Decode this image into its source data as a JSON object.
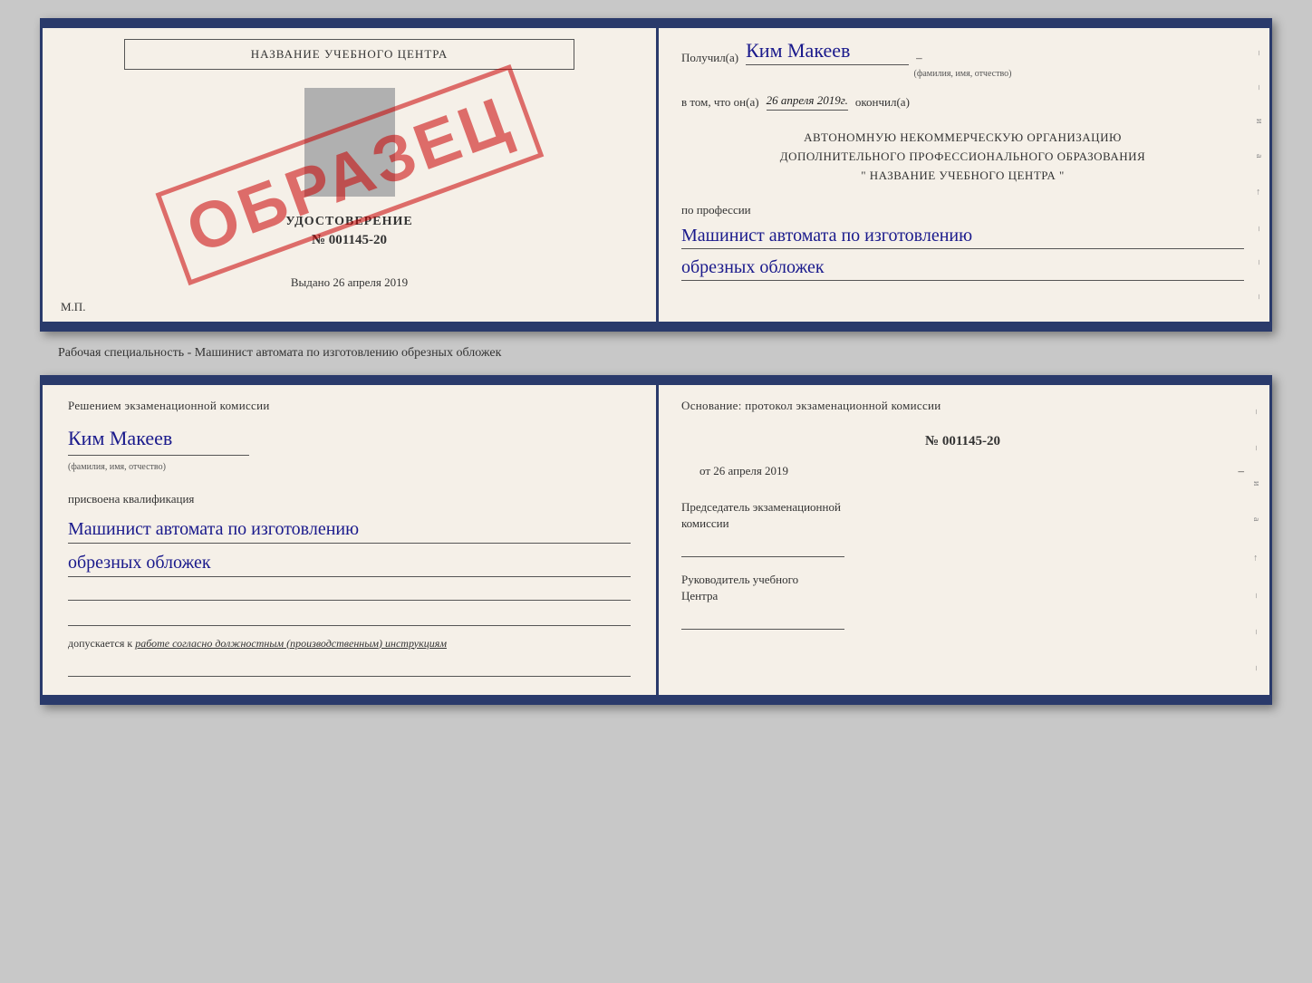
{
  "doc1": {
    "left": {
      "school_name": "НАЗВАНИЕ УЧЕБНОГО ЦЕНТРА",
      "udostoverenie_label": "УДОСТОВЕРЕНИЕ",
      "number": "№ 001145-20",
      "vydano_label": "Выдано",
      "vydano_date": "26 апреля 2019",
      "mp_label": "М.П.",
      "obrazec": "ОБРАЗЕЦ"
    },
    "right": {
      "poluchil": "Получил(a)",
      "name": "Ким Макеев",
      "fio_hint": "(фамилия, имя, отчество)",
      "dash1": "–",
      "v_tom": "в том, что он(а)",
      "date": "26 апреля 2019г.",
      "okonchil": "окончил(а)",
      "org_line1": "АВТОНОМНУЮ НЕКОММЕРЧЕСКУЮ ОРГАНИЗАЦИЮ",
      "org_line2": "ДОПОЛНИТЕЛЬНОГО ПРОФЕССИОНАЛЬНОГО ОБРАЗОВАНИЯ",
      "org_name": "\"  НАЗВАНИЕ УЧЕБНОГО ЦЕНТРА  \"",
      "po_professii": "по профессии",
      "profession1": "Машинист автомата по изготовлению",
      "profession2": "обрезных обложек"
    }
  },
  "separator": {
    "text": "Рабочая специальность - Машинист автомата по изготовлению обрезных обложек"
  },
  "doc2": {
    "left": {
      "resheniem": "Решением экзаменационной комиссии",
      "name": "Ким Макеев",
      "fio_hint": "(фамилия, имя, отчество)",
      "prisvoena": "присвоена квалификация",
      "qual1": "Машинист автомата по изготовлению",
      "qual2": "обрезных обложек",
      "dopuskaetsya": "допускается к",
      "dopusk_text": "работе согласно должностным (производственным) инструкциям"
    },
    "right": {
      "osnovanie": "Основание: протокол экзаменационной комиссии",
      "number": "№ 001145-20",
      "ot_label": "от",
      "date": "26 апреля 2019",
      "predsedatel_label": "Председатель экзаменационной",
      "predsedatel_label2": "комиссии",
      "rukovoditel_label": "Руководитель учебного",
      "rukovoditel_label2": "Центра"
    }
  },
  "edge_marks": [
    "–",
    "–",
    "и",
    "а",
    "←",
    "–",
    "–",
    "–"
  ]
}
